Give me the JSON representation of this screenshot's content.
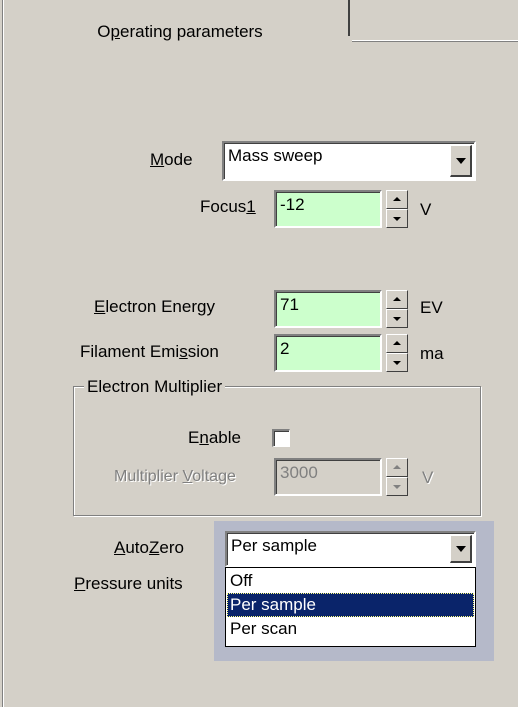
{
  "tab": {
    "label": "Operating parameters"
  },
  "mode": {
    "label": "Mode",
    "value": "Mass sweep"
  },
  "focus1": {
    "label": "Focus1",
    "value": "-12",
    "unit": "V"
  },
  "electron_energy": {
    "label": "Electron Energy",
    "value": "71",
    "unit": "EV"
  },
  "filament_emission": {
    "label": "Filament Emission",
    "value": "2",
    "unit": "ma"
  },
  "electron_multiplier": {
    "title": "Electron Multiplier",
    "enable_label": "Enable",
    "enabled": false,
    "voltage_label": "Multiplier Voltage",
    "voltage_value": "3000",
    "voltage_unit": "V"
  },
  "autozero": {
    "label": "AutoZero",
    "value": "Per sample",
    "options": [
      "Off",
      "Per sample",
      "Per scan"
    ],
    "selected_option": "Per sample"
  },
  "pressure_units": {
    "label": "Pressure units"
  },
  "colors": {
    "field_green": "#ccffcc",
    "selection": "#0a246a",
    "dialog_bg": "#d4d0c8"
  },
  "icons": {
    "spinner": "up-down-arrows",
    "dropdown": "chevron-down"
  }
}
